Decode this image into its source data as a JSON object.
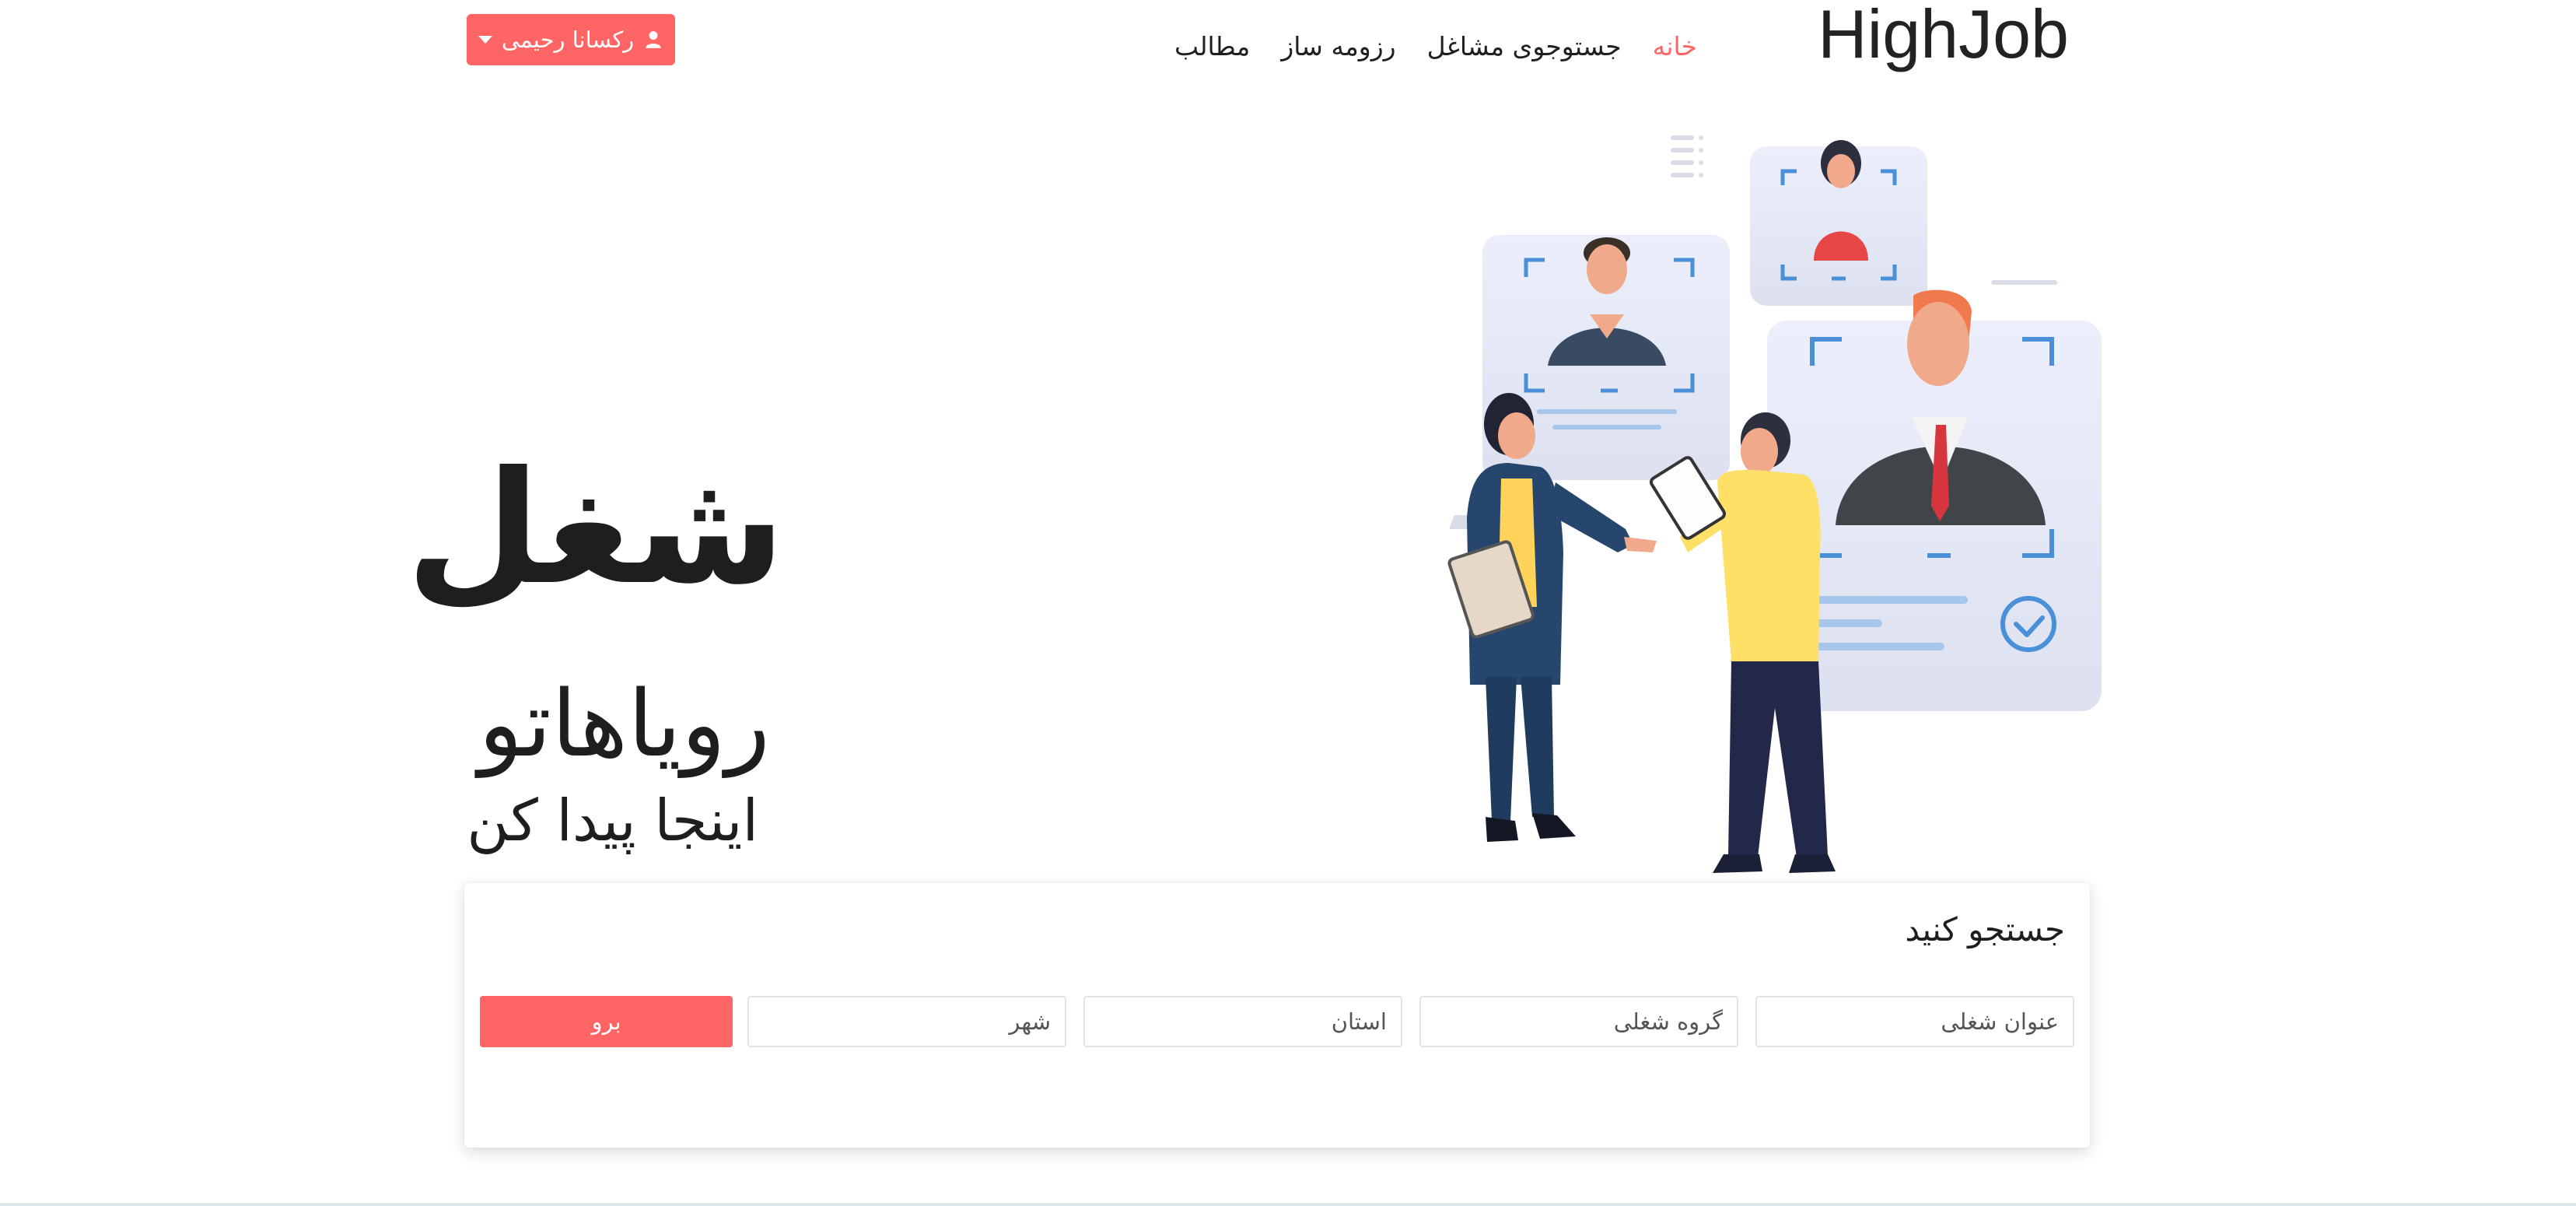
{
  "navbar": {
    "brand": "HighJob",
    "links": [
      {
        "label": "خانه",
        "active": true
      },
      {
        "label": "جستوجوی مشاغل",
        "active": false
      },
      {
        "label": "رزومه ساز",
        "active": false
      },
      {
        "label": "مطالب",
        "active": false
      }
    ],
    "user": {
      "name": "رکسانا رحیمی",
      "icon": "user-icon",
      "caret": "caret-down-icon"
    }
  },
  "hero": {
    "title": "شغل",
    "subtitle": "رویاهاتو",
    "tagline": "اینجا پیدا کن"
  },
  "search": {
    "title": "جستجو کنید",
    "fields": {
      "job_title_placeholder": "عنوان شغلی",
      "job_group_placeholder": "گروه شغلی",
      "province_placeholder": "استان",
      "city_placeholder": "شهر"
    },
    "submit_label": "برو"
  },
  "colors": {
    "accent": "#ff6565",
    "text": "#1e1e1e",
    "illustration_yellow": "#ffe066",
    "illustration_navy": "#23284a",
    "illustration_blue": "#4a90d9"
  }
}
